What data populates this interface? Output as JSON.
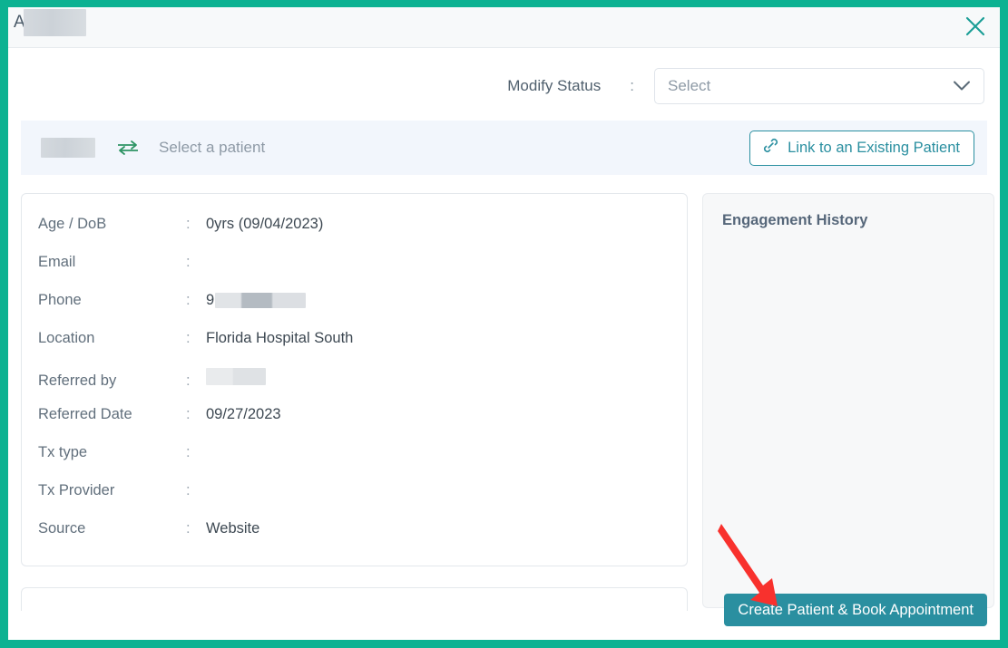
{
  "window": {
    "title_prefix": "A",
    "title_redacted": true,
    "close_icon": "close-icon",
    "frame_color": "#0cb292"
  },
  "status": {
    "label": "Modify Status",
    "separator": ":",
    "select_value": "Select",
    "chevron_icon": "chevron-down-icon"
  },
  "patient_bar": {
    "name_redacted": true,
    "swap_icon": "exchange-arrows-icon",
    "placeholder": "Select a patient",
    "link_button_label": "Link to an Existing Patient",
    "link_icon": "link-chain-icon",
    "accent_color": "#2a8fa0"
  },
  "details": {
    "rows": [
      {
        "label": "Age / DoB",
        "separator": ":",
        "value": "0yrs (09/04/2023)",
        "redacted": false
      },
      {
        "label": "Email",
        "separator": ":",
        "value": "",
        "redacted": false
      },
      {
        "label": "Phone",
        "separator": ":",
        "value": "9",
        "redacted": true
      },
      {
        "label": "Location",
        "separator": ":",
        "value": "Florida Hospital South",
        "redacted": false
      },
      {
        "label": "Referred by",
        "separator": ":",
        "value": "",
        "redacted": true
      },
      {
        "label": "Referred Date",
        "separator": ":",
        "value": "09/27/2023",
        "redacted": false
      },
      {
        "label": "Tx type",
        "separator": ":",
        "value": "",
        "redacted": false
      },
      {
        "label": "Tx Provider",
        "separator": ":",
        "value": "",
        "redacted": false
      },
      {
        "label": "Source",
        "separator": ":",
        "value": "Website",
        "redacted": false
      }
    ]
  },
  "engagement": {
    "title": "Engagement History",
    "items": []
  },
  "footer": {
    "primary_button_label": "Create Patient & Book Appointment",
    "primary_button_color": "#2a8fa0"
  },
  "annotation": {
    "arrow_color": "#f8312d",
    "points_to": "Create Patient & Book Appointment"
  }
}
